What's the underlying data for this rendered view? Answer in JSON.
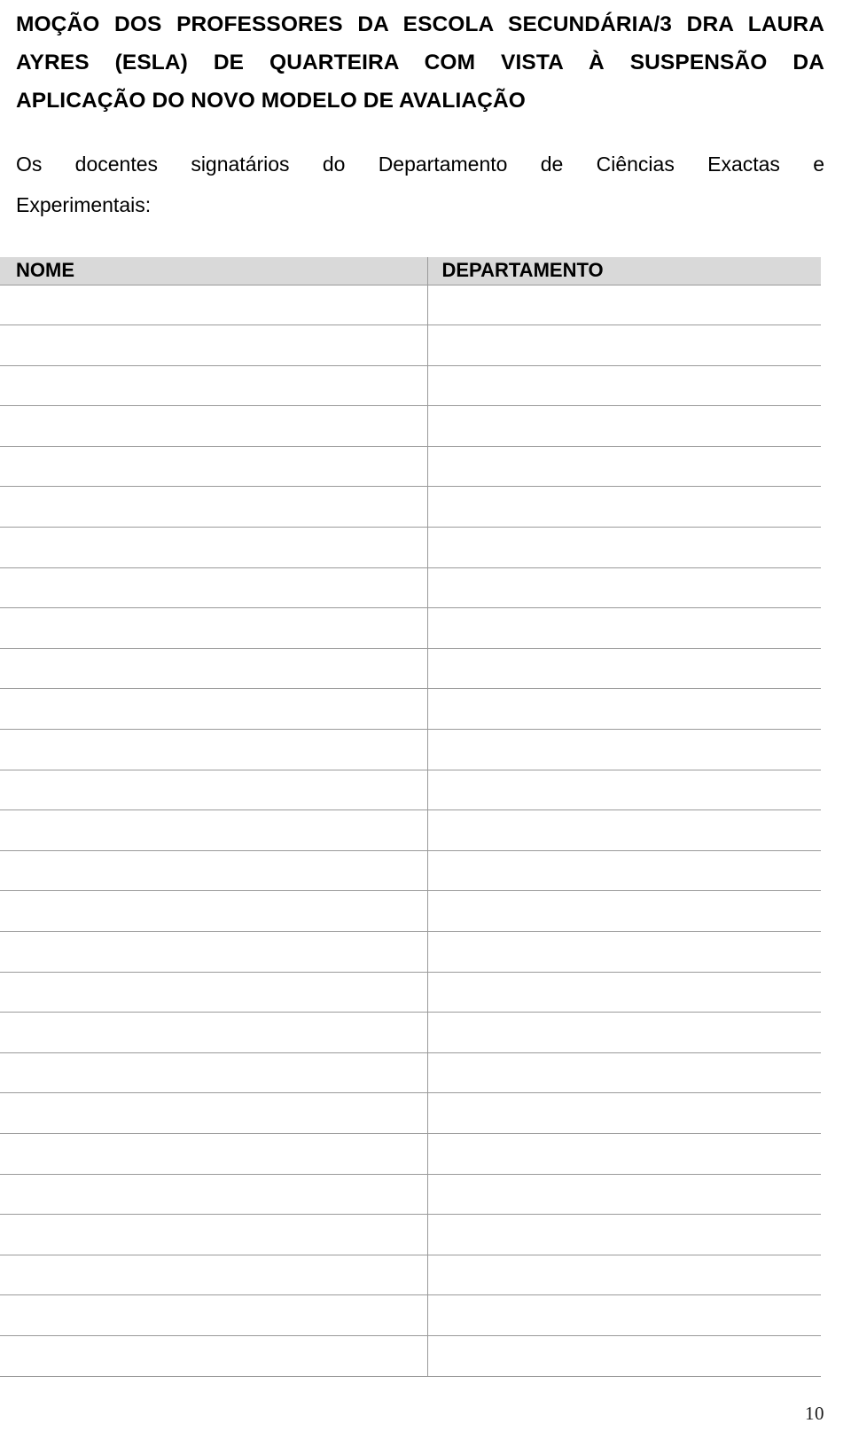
{
  "document": {
    "title_lines": [
      "MOÇÃO DOS PROFESSORES DA ESCOLA SECUNDÁRIA/3 DRA LAURA",
      "AYRES (ESLA) DE QUARTEIRA COM VISTA À SUSPENSÃO DA",
      "APLICAÇÃO DO NOVO MODELO DE AVALIAÇÃO"
    ],
    "title_full": "MOÇÃO DOS PROFESSORES DA ESCOLA SECUNDÁRIA/3 DRA LAURA AYRES (ESLA) DE QUARTEIRA COM VISTA À SUSPENSÃO DA APLICAÇÃO DO NOVO MODELO DE AVALIAÇÃO",
    "paragraph_lines": [
      "Os docentes signatários do Departamento de Ciências Exactas e",
      "Experimentais:"
    ],
    "paragraph_full": "Os docentes signatários do Departamento de Ciências Exactas e Experimentais:",
    "page_number": "10"
  },
  "signature_table": {
    "columns": [
      {
        "key": "nome",
        "label": "NOME"
      },
      {
        "key": "departamento",
        "label": "DEPARTAMENTO"
      }
    ],
    "row_count": 27,
    "rows": [
      {
        "nome": "",
        "departamento": ""
      },
      {
        "nome": "",
        "departamento": ""
      },
      {
        "nome": "",
        "departamento": ""
      },
      {
        "nome": "",
        "departamento": ""
      },
      {
        "nome": "",
        "departamento": ""
      },
      {
        "nome": "",
        "departamento": ""
      },
      {
        "nome": "",
        "departamento": ""
      },
      {
        "nome": "",
        "departamento": ""
      },
      {
        "nome": "",
        "departamento": ""
      },
      {
        "nome": "",
        "departamento": ""
      },
      {
        "nome": "",
        "departamento": ""
      },
      {
        "nome": "",
        "departamento": ""
      },
      {
        "nome": "",
        "departamento": ""
      },
      {
        "nome": "",
        "departamento": ""
      },
      {
        "nome": "",
        "departamento": ""
      },
      {
        "nome": "",
        "departamento": ""
      },
      {
        "nome": "",
        "departamento": ""
      },
      {
        "nome": "",
        "departamento": ""
      },
      {
        "nome": "",
        "departamento": ""
      },
      {
        "nome": "",
        "departamento": ""
      },
      {
        "nome": "",
        "departamento": ""
      },
      {
        "nome": "",
        "departamento": ""
      },
      {
        "nome": "",
        "departamento": ""
      },
      {
        "nome": "",
        "departamento": ""
      },
      {
        "nome": "",
        "departamento": ""
      },
      {
        "nome": "",
        "departamento": ""
      },
      {
        "nome": "",
        "departamento": ""
      }
    ]
  },
  "colors": {
    "page_background": "#ffffff",
    "text": "#000000",
    "table_header_background": "#d9d9d9",
    "table_rule": "#9a9a9a"
  }
}
